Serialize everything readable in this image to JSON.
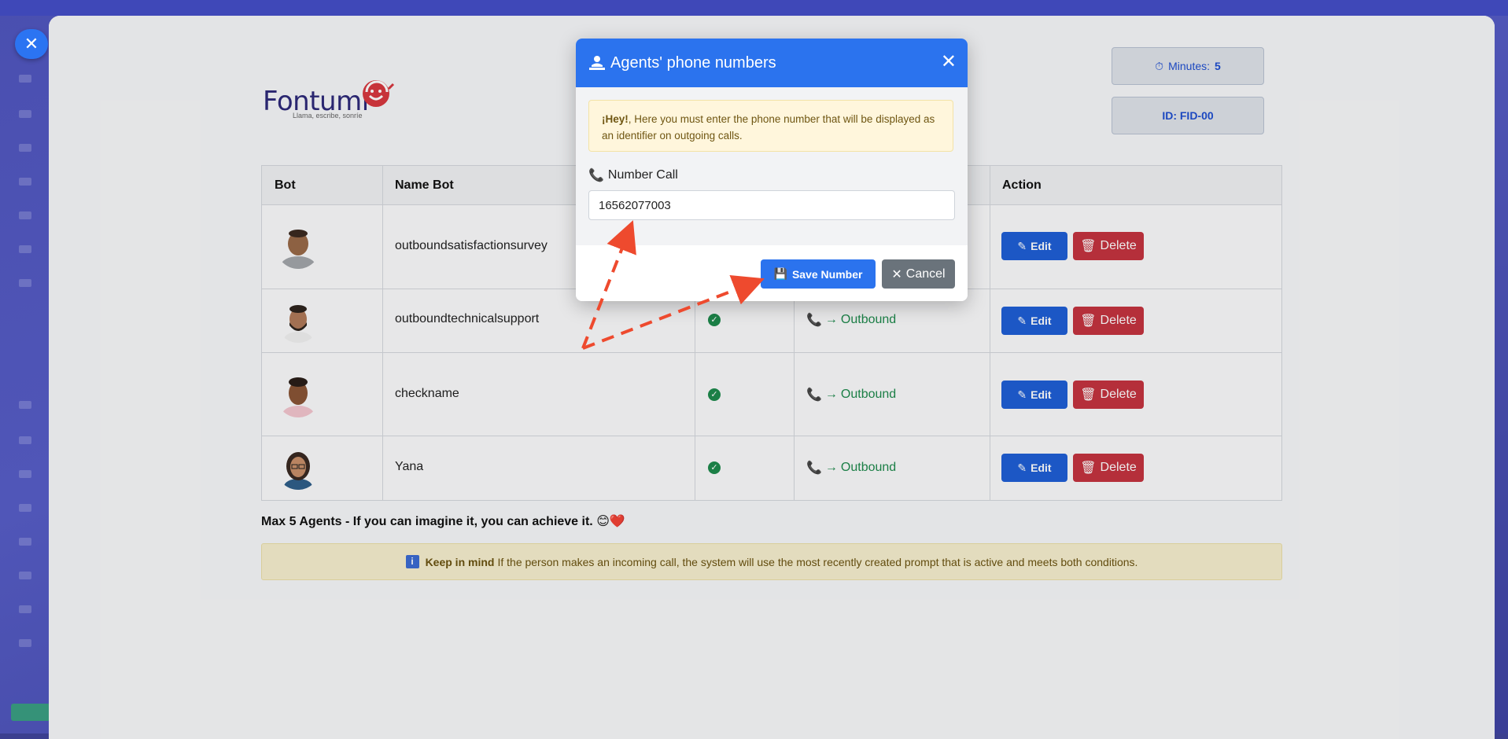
{
  "colors": {
    "primary": "#2b73ee",
    "danger": "#c5333f",
    "success": "#1e8a4c",
    "secondary": "#6a737b",
    "annotation_arrow": "#ee4a2e"
  },
  "logo": {
    "text": "Fontumi",
    "tagline": "Llama, escribe, sonríe"
  },
  "stats": {
    "minutes_label": "Minutes:",
    "minutes_value": "5",
    "id_label": "ID: FID-00"
  },
  "table": {
    "headers": [
      "Bot",
      "Name Bot",
      "Action"
    ],
    "rows": [
      {
        "name": "outboundsatisfactionsurvey",
        "direction": "",
        "edit": "Edit",
        "delete": "Delete"
      },
      {
        "name": "outboundtechnicalsupport",
        "direction": "Outbound",
        "edit": "Edit",
        "delete": "Delete"
      },
      {
        "name": "checkname",
        "direction": "Outbound",
        "edit": "Edit",
        "delete": "Delete"
      },
      {
        "name": "Yana",
        "direction": "Outbound",
        "edit": "Edit",
        "delete": "Delete"
      }
    ]
  },
  "footer": {
    "motto": "Max 5 Agents - If you can imagine it, you can achieve it. 😊❤️",
    "notice_strong": "Keep in mind",
    "notice_text": "If the person makes an incoming call, the system will use the most recently created prompt that is active and meets both conditions."
  },
  "modal": {
    "title": "Agents' phone numbers",
    "alert_strong": "¡Hey!",
    "alert_text": ", Here you must enter the phone number that will be displayed as an identifier on outgoing calls.",
    "field_label": "Number Call",
    "field_value": "16562077003",
    "save_label": "Save Number",
    "cancel_label": "Cancel"
  }
}
